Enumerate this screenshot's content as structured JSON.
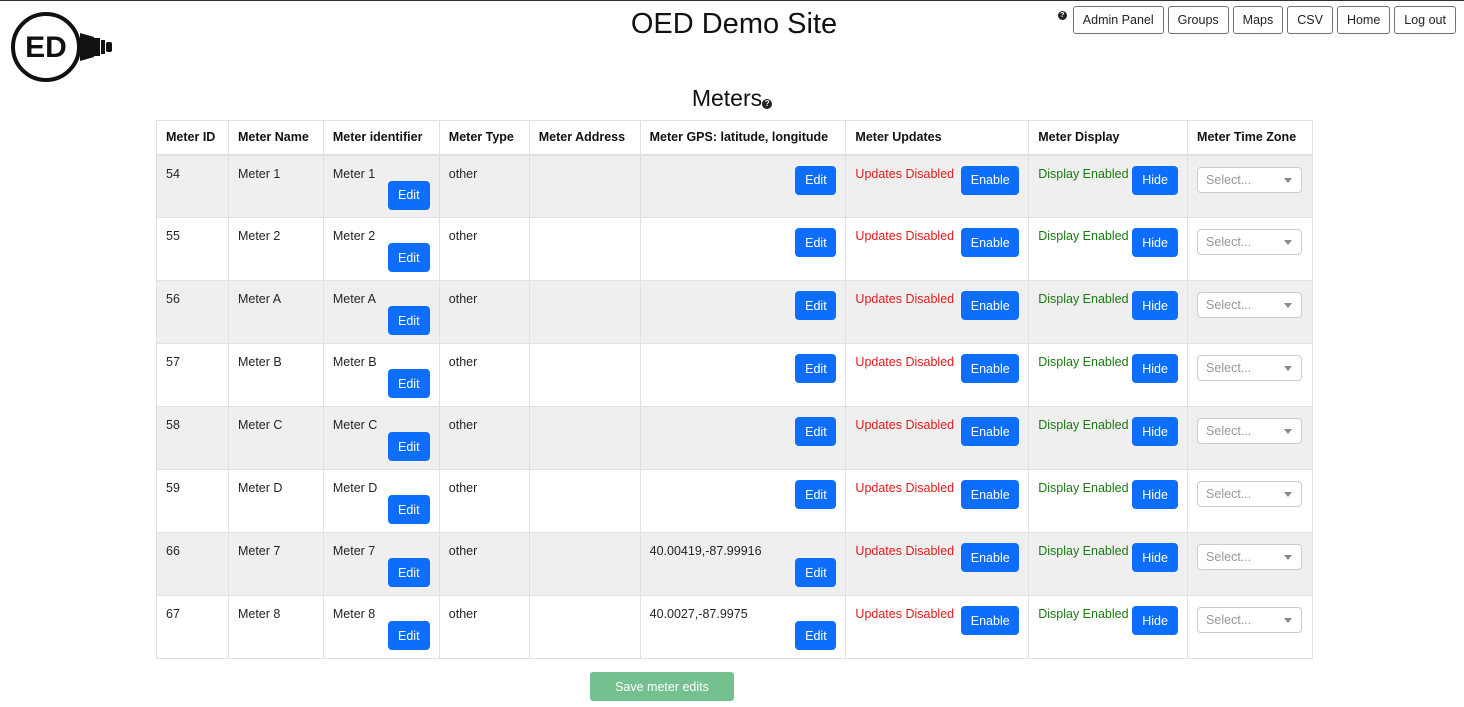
{
  "header": {
    "title": "OED Demo Site",
    "logo_text": "ED",
    "nav": [
      "Admin Panel",
      "Groups",
      "Maps",
      "CSV",
      "Home",
      "Log out"
    ]
  },
  "page": {
    "heading": "Meters",
    "columns": [
      "Meter ID",
      "Meter Name",
      "Meter identifier",
      "Meter Type",
      "Meter Address",
      "Meter GPS: latitude, longitude",
      "Meter Updates",
      "Meter Display",
      "Meter Time Zone"
    ],
    "labels": {
      "edit": "Edit",
      "enable": "Enable",
      "hide": "Hide",
      "select_placeholder": "Select..."
    },
    "rows": [
      {
        "id": "54",
        "name": "Meter 1",
        "identifier": "Meter 1",
        "type": "other",
        "address": "",
        "gps": "",
        "updates": "Updates Disabled",
        "display": "Display Enabled"
      },
      {
        "id": "55",
        "name": "Meter 2",
        "identifier": "Meter 2",
        "type": "other",
        "address": "",
        "gps": "",
        "updates": "Updates Disabled",
        "display": "Display Enabled"
      },
      {
        "id": "56",
        "name": "Meter A",
        "identifier": "Meter A",
        "type": "other",
        "address": "",
        "gps": "",
        "updates": "Updates Disabled",
        "display": "Display Enabled"
      },
      {
        "id": "57",
        "name": "Meter B",
        "identifier": "Meter B",
        "type": "other",
        "address": "",
        "gps": "",
        "updates": "Updates Disabled",
        "display": "Display Enabled"
      },
      {
        "id": "58",
        "name": "Meter C",
        "identifier": "Meter C",
        "type": "other",
        "address": "",
        "gps": "",
        "updates": "Updates Disabled",
        "display": "Display Enabled"
      },
      {
        "id": "59",
        "name": "Meter D",
        "identifier": "Meter D",
        "type": "other",
        "address": "",
        "gps": "",
        "updates": "Updates Disabled",
        "display": "Display Enabled"
      },
      {
        "id": "66",
        "name": "Meter 7",
        "identifier": "Meter 7",
        "type": "other",
        "address": "",
        "gps": "40.00419,-87.99916",
        "updates": "Updates Disabled",
        "display": "Display Enabled"
      },
      {
        "id": "67",
        "name": "Meter 8",
        "identifier": "Meter 8",
        "type": "other",
        "address": "",
        "gps": "40.0027,-87.9975",
        "updates": "Updates Disabled",
        "display": "Display Enabled"
      }
    ],
    "save_label": "Save meter edits"
  },
  "colors": {
    "primary": "#0d6efd",
    "disabled_red": "#e31b1b",
    "enabled_green": "#1a7a12",
    "save_green": "#74c08f",
    "row_stripe": "#efefef"
  },
  "icons": {
    "logo": "lightbulb-ed-logo",
    "help": "question-circle-icon",
    "select": "chevron-down-icon"
  }
}
